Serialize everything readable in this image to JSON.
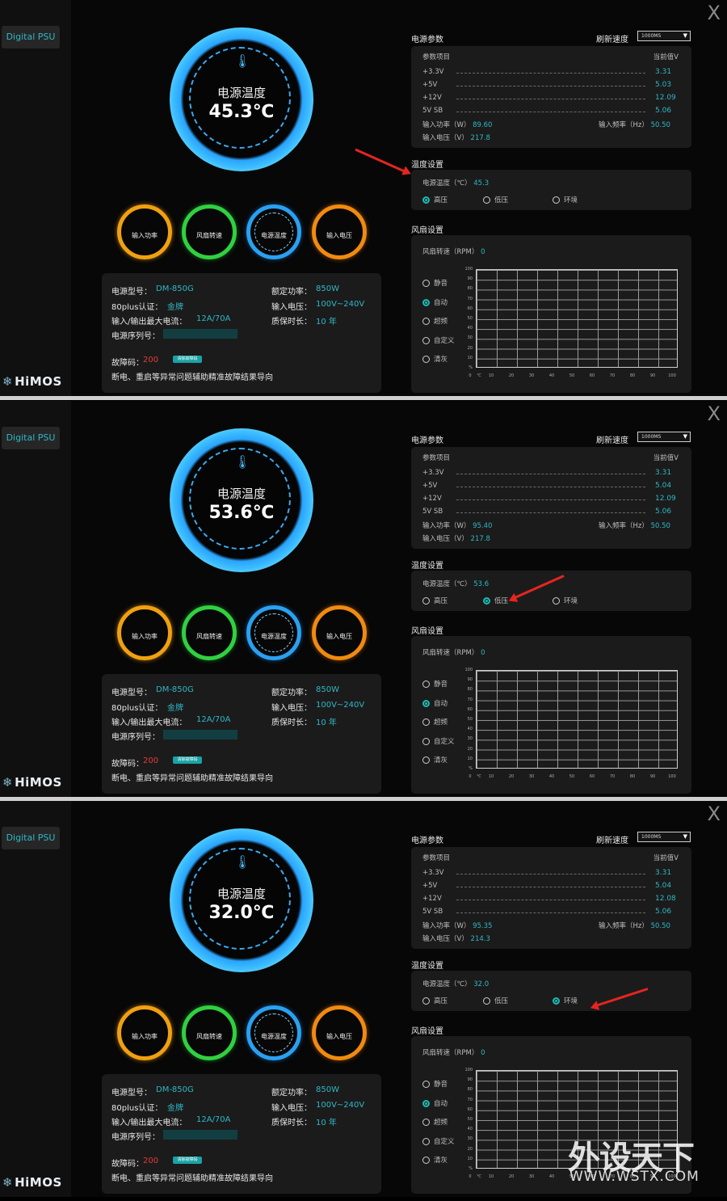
{
  "app": {
    "sidebar_tab": "Digital PSU",
    "logo": "HiMOS",
    "close_glyph": "X",
    "watermark": "外设天下",
    "watermark_url": "WWW.WSTX.COM"
  },
  "labels": {
    "temp_title": "电源温度",
    "unit": "℃",
    "gauges": [
      "输入功率",
      "风扇转速",
      "电源温度",
      "输入电压"
    ],
    "model_k": "电源型号：",
    "cert_k": "80plus认证：",
    "current_k": "输入/输出最大电流：",
    "serial_k": "电源序列号：",
    "rated_k": "额定功率：",
    "voltage_k": "输入电压：",
    "warranty_k": "质保时长：",
    "err_k": "故障码：",
    "err_btn": "清除故障码",
    "err_desc": "断电、重启等异常问题辅助精准故障结果导向",
    "params_title": "电源参数",
    "refresh_label": "刷新速度",
    "refresh_value": "1000MS",
    "param_header_left": "参数项目",
    "param_header_right": "当前值V",
    "rails": [
      "+3.3V",
      "+5V",
      "+12V",
      "5V SB"
    ],
    "power_k": "输入功率（W）",
    "freq_k": "输入频率（Hz）",
    "vin_k": "输入电压（V）",
    "temp_settings_title": "温度设置",
    "temp_row_k": "电源温度（℃）",
    "temp_modes": [
      "高压",
      "低压",
      "环境"
    ],
    "fan_title": "风扇设置",
    "fan_rpm_k": "风扇转速（RPM）",
    "fan_modes": [
      "静音",
      "自动",
      "超频",
      "自定义",
      "清灰"
    ],
    "y_ticks": [
      "100",
      "90",
      "80",
      "70",
      "60",
      "50",
      "40",
      "30",
      "20",
      "10",
      "%"
    ],
    "x_ticks": [
      "0",
      "℃",
      "10",
      "20",
      "30",
      "40",
      "50",
      "60",
      "70",
      "80",
      "90",
      "100"
    ]
  },
  "device": {
    "model": "DM-850G",
    "cert": "金牌",
    "current": "12A/70A",
    "rated": "850W",
    "voltage": "100V~240V",
    "warranty": "10 年",
    "err_code": "200",
    "fan_rpm": "0",
    "freq": "50.50"
  },
  "panels": [
    {
      "temp": "45.3℃",
      "rails": [
        "3.31",
        "5.03",
        "12.09",
        "5.06"
      ],
      "power": "89.60",
      "vin": "217.8",
      "temp_setting": "45.3",
      "temp_mode": 0,
      "fan_mode": 1
    },
    {
      "temp": "53.6℃",
      "rails": [
        "3.31",
        "5.04",
        "12.09",
        "5.06"
      ],
      "power": "95.40",
      "vin": "217.8",
      "temp_setting": "53.6",
      "temp_mode": 1,
      "fan_mode": 1
    },
    {
      "temp": "32.0℃",
      "rails": [
        "3.31",
        "5.04",
        "12.08",
        "5.06"
      ],
      "power": "95.35",
      "vin": "214.3",
      "temp_setting": "32.0",
      "temp_mode": 2,
      "fan_mode": 1
    }
  ],
  "colors": {
    "accent": "#2fb7c6",
    "error": "#e33b3b",
    "annotation_arrow": "#e5251f"
  }
}
